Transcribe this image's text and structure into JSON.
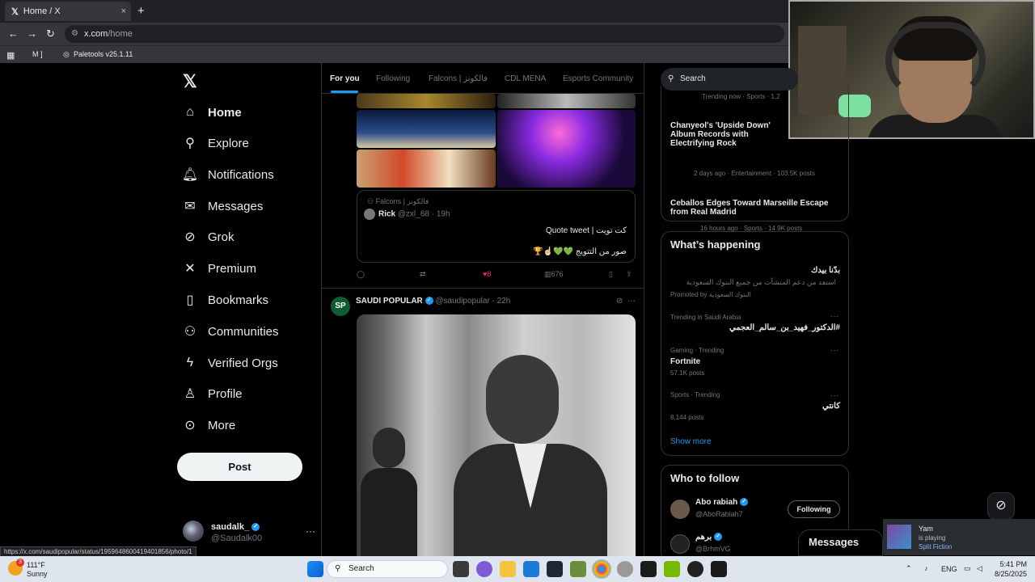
{
  "browser": {
    "tab_title": "Home / X",
    "tab_icon": "𝕏",
    "close": "×",
    "new_tab": "+",
    "url_host": "x.com",
    "url_path": "/home",
    "bookmarks": [
      "M ]",
      "Paletools v25.1.11"
    ]
  },
  "sidebar": {
    "logo": "𝕏",
    "items": [
      {
        "label": "Home",
        "icon": "home-icon"
      },
      {
        "label": "Explore",
        "icon": "search-icon"
      },
      {
        "label": "Notifications",
        "icon": "bell-icon"
      },
      {
        "label": "Messages",
        "icon": "envelope-icon"
      },
      {
        "label": "Grok",
        "icon": "grok-icon"
      },
      {
        "label": "Premium",
        "icon": "x-icon"
      },
      {
        "label": "Bookmarks",
        "icon": "bookmark-icon"
      },
      {
        "label": "Communities",
        "icon": "people-icon"
      },
      {
        "label": "Verified Orgs",
        "icon": "lightning-icon"
      },
      {
        "label": "Profile",
        "icon": "person-icon"
      },
      {
        "label": "More",
        "icon": "more-circle-icon"
      }
    ],
    "post_label": "Post",
    "account": {
      "name": "saudalk_",
      "handle": "@Saudalk00"
    }
  },
  "feed": {
    "tabs": [
      "For you",
      "Following",
      "Falcons | فالكونز",
      "CDL MENA",
      "Esports Community"
    ],
    "quote": {
      "community": "Falcons | فالكونز",
      "author": "Rick",
      "handle": "@zxl_68 · 19h",
      "line1": "كت تويت | Quote tweet",
      "line2": "صور من التتويج 💚💚☝🏻🏆"
    },
    "actions": {
      "likes": "8",
      "views": "676"
    },
    "post": {
      "avatar": "SP",
      "name": "SAUDI POPULAR",
      "handle": "@saudipopular · 22h"
    }
  },
  "right": {
    "search_placeholder": "Search",
    "top_trends": [
      {
        "meta": "Trending now · Sports · 1,2"
      },
      {
        "title": "Chanyeol's 'Upside Down' Album Records with Electrifying Rock",
        "meta": "2 days ago · Entertainment · 103.5K posts"
      },
      {
        "title": "Ceballos Edges Toward Marseille Escape from Real Madrid",
        "meta": "16 hours ago · Sports · 14.9K posts"
      }
    ],
    "happening": {
      "title": "What’s happening",
      "promo_title": "بدّنا بيدك",
      "promo_text": "استفد من دعم المنشآت من جميع البنوك السعودية",
      "promo_by": "Promoted by البنوك السعودية",
      "trends": [
        {
          "meta": "Trending in Saudi Arabia",
          "title": "#الدكتور_فهيد_بن_سالم_العجمي",
          "count": ""
        },
        {
          "meta": "Gaming · Trending",
          "title": "Fortnite",
          "count": "57.1K posts"
        },
        {
          "meta": "Sports · Trending",
          "title": "كانتي",
          "count": "8,144 posts"
        }
      ],
      "show_more": "Show more"
    },
    "who_to_follow": {
      "title": "Who to follow",
      "users": [
        {
          "name": "Abo rabiah",
          "handle": "@AboRabiah7",
          "button": "Following"
        },
        {
          "name": "برهم",
          "handle": "@BrhmVG",
          "button": ""
        }
      ]
    },
    "messages": "Messages"
  },
  "overlay": {
    "status_url": "https://x.com/saudipopular/status/1959648600419401856/photo/1",
    "toast_name": "Yam",
    "toast_status": "is playing",
    "toast_game": "Split Fiction"
  },
  "taskbar": {
    "weather_temp": "111°F",
    "weather_desc": "Sunny",
    "search": "Search",
    "lang": "ENG",
    "time": "5:41 PM",
    "date": "8/25/2025",
    "notif_count": "3"
  }
}
